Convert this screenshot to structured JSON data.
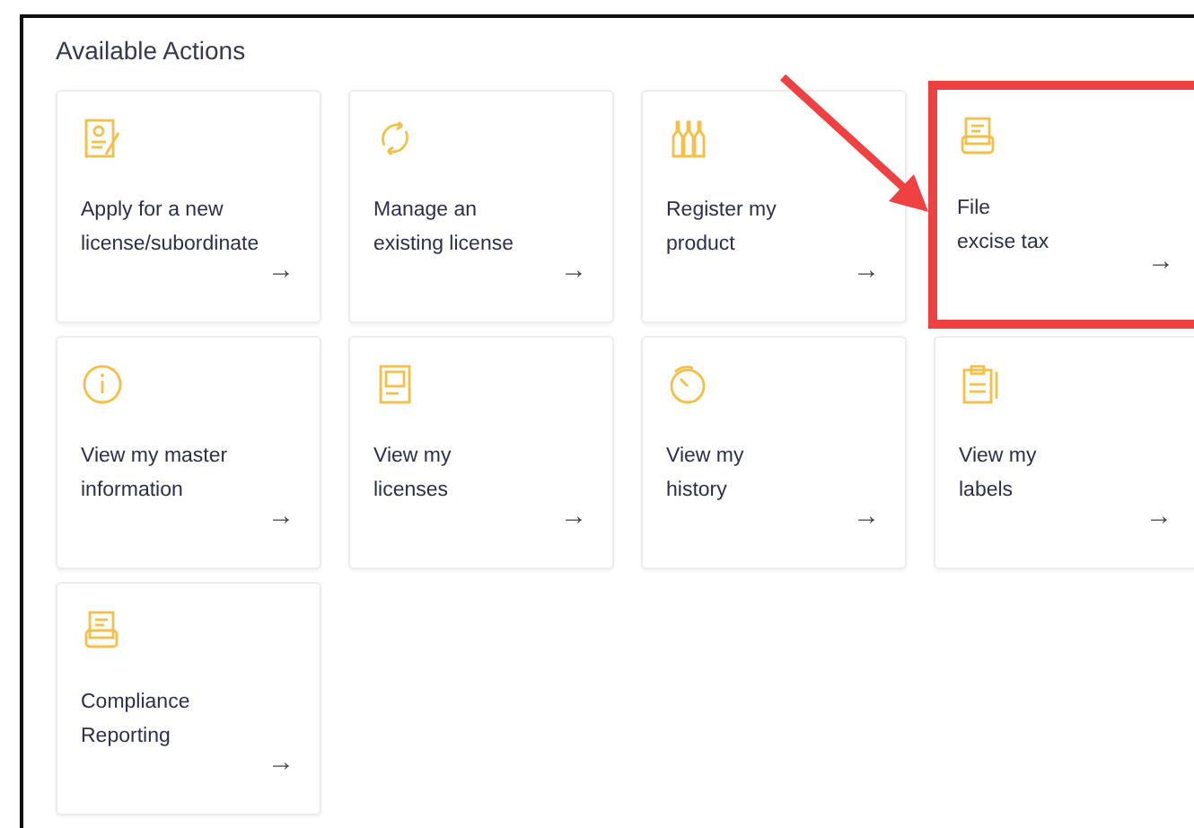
{
  "section": {
    "title": "Available Actions"
  },
  "actions": [
    {
      "label": "Apply for a new\nlicense/subordinate",
      "arrow": "→",
      "highlighted": false
    },
    {
      "label": "Manage an\nexisting license",
      "arrow": "→",
      "highlighted": false
    },
    {
      "label": "Register my\nproduct",
      "arrow": "→",
      "highlighted": false
    },
    {
      "label": "File\nexcise tax",
      "arrow": "→",
      "highlighted": true
    },
    {
      "label": "View my master\ninformation",
      "arrow": "→",
      "highlighted": false
    },
    {
      "label": "View my\nlicenses",
      "arrow": "→",
      "highlighted": false
    },
    {
      "label": "View my\nhistory",
      "arrow": "→",
      "highlighted": false
    },
    {
      "label": "View my\nlabels",
      "arrow": "→",
      "highlighted": false
    },
    {
      "label": "Compliance\nReporting",
      "arrow": "→",
      "highlighted": false
    }
  ]
}
